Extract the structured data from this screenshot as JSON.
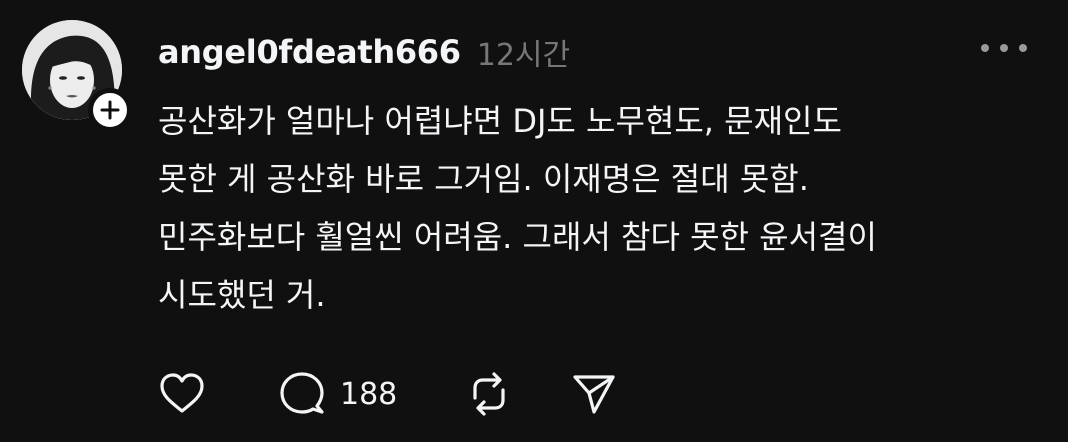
{
  "post": {
    "username": "angel0fdeath666",
    "timestamp": "12시간",
    "body_lines": [
      "공산화가 얼마나 어렵냐면 DJ도 노무현도, 문재인도",
      "못한 게 공산화 바로 그거임. 이재명은 절대 못함.",
      "민주화보다 훨얼씬 어려움. 그래서 참다 못한 윤서결이",
      "시도했던 거."
    ],
    "avatar_icon": "profile-photo",
    "follow_icon": "plus-icon",
    "more_icon": "more-icon"
  },
  "actions": {
    "like_icon": "heart-icon",
    "comment_icon": "comment-icon",
    "comment_count": "188",
    "repost_icon": "repost-icon",
    "share_icon": "send-icon"
  },
  "colors": {
    "background": "#101010",
    "text": "#f3f5f7",
    "muted": "#777777"
  }
}
